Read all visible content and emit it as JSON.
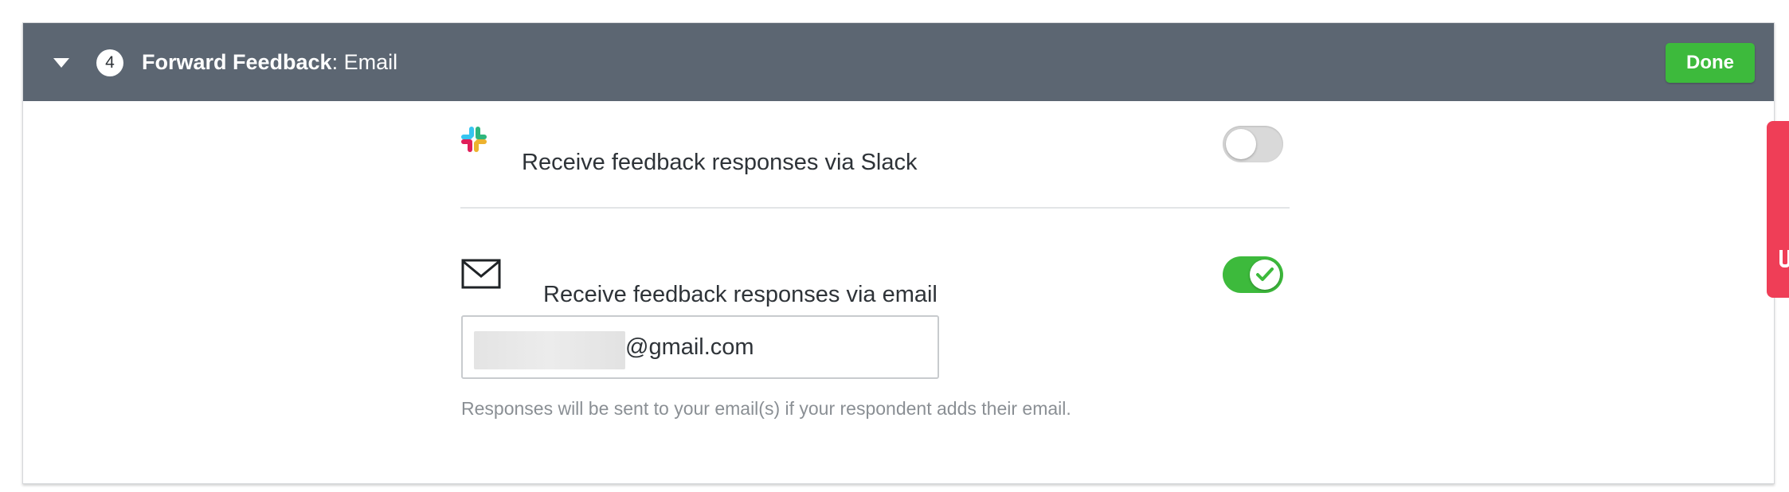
{
  "header": {
    "step_number": "4",
    "title_strong": "Forward Feedback",
    "title_rest": ": Email",
    "done_label": "Done"
  },
  "slack_row": {
    "label": "Receive feedback responses via Slack",
    "icon": "slack-icon",
    "enabled": false
  },
  "email_row": {
    "label": "Receive feedback responses via email",
    "icon": "mail-icon",
    "enabled": true,
    "email_value_visible": "@gmail.com",
    "hint": "Responses will be sent to your email(s) if your respondent adds their email."
  },
  "colors": {
    "header_bg": "#5c6672",
    "done_green": "#3dba3c",
    "toggle_on": "#3dba3c",
    "toggle_off": "#d9d9d9",
    "side_tab": "#ef3e57"
  }
}
